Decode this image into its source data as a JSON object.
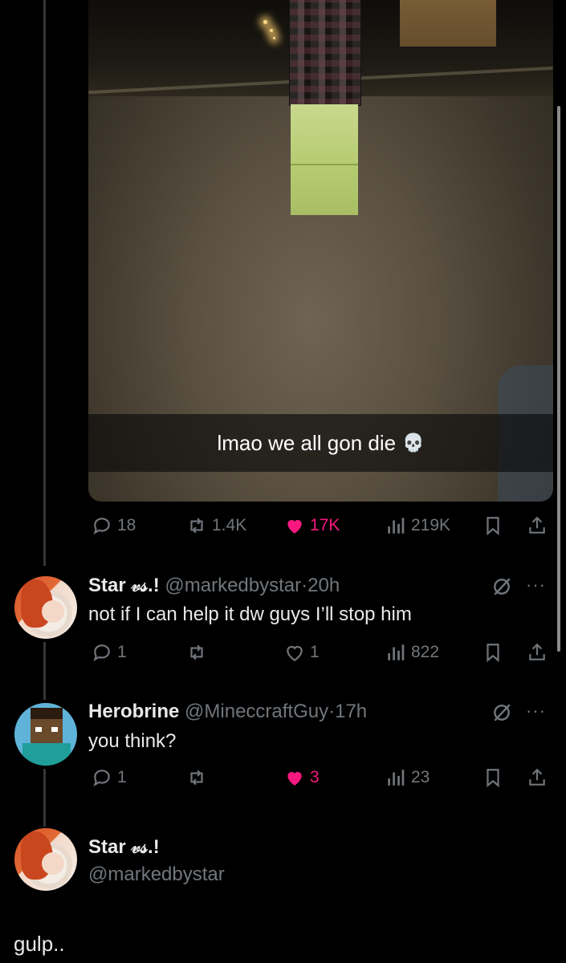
{
  "colors": {
    "background": "#000000",
    "muted": "#71767b",
    "like_pink": "#f91880",
    "text": "#e7e9ea"
  },
  "main_tweet": {
    "caption": "lmao we all gon die",
    "caption_emoji": "💀",
    "metrics": {
      "replies": "18",
      "reposts": "1.4K",
      "likes": "17K",
      "views": "219K"
    },
    "liked": true
  },
  "replies": [
    {
      "name": "Star 𝓋𝓈.!",
      "handle": "@markedbystar",
      "time": "20h",
      "text": "not if I can help it dw guys I’ll stop him",
      "metrics": {
        "replies": "1",
        "reposts": "",
        "likes": "1",
        "views": "822"
      },
      "liked": false
    },
    {
      "name": "Herobrine",
      "handle": "@MineccraftGuy",
      "time": "17h",
      "text": "you think?",
      "metrics": {
        "replies": "1",
        "reposts": "",
        "likes": "3",
        "views": "23"
      },
      "liked": true
    }
  ],
  "composer": {
    "name": "Star 𝓋𝓈.!",
    "handle": "@markedbystar"
  },
  "footer_text": "gulp.."
}
